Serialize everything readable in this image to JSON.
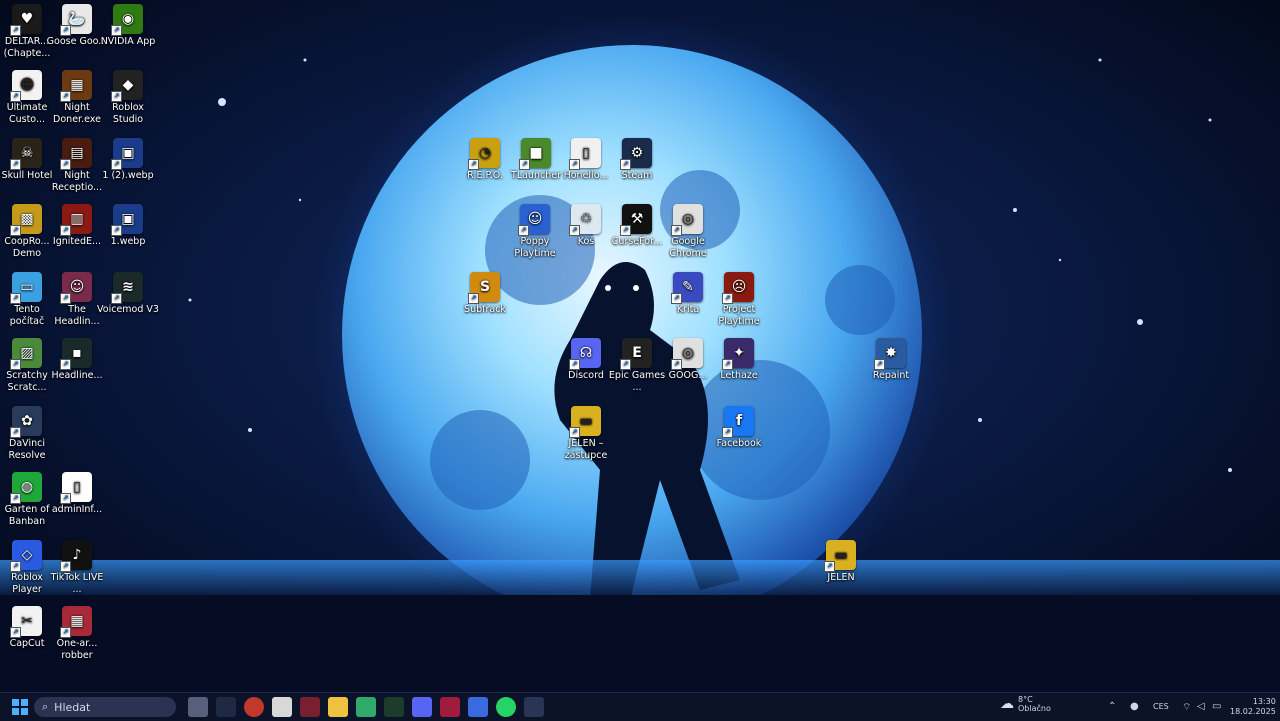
{
  "desktop_icons": [
    {
      "label": "DELTAR... (Chapte...",
      "color": "#1a1a1a",
      "glyph": "♥"
    },
    {
      "label": "Goose Goo...",
      "color": "#e8e8e8",
      "glyph": "🦢"
    },
    {
      "label": "NVIDIA App",
      "color": "#2f7a12",
      "glyph": "◉"
    },
    {
      "label": "Ultimate Custo...",
      "color": "#f2f2f2",
      "glyph": "☻"
    },
    {
      "label": "Night Doner.exe",
      "color": "#6b3a12",
      "glyph": "▦"
    },
    {
      "label": "Roblox Studio",
      "color": "#222",
      "glyph": "◆"
    },
    {
      "label": "Skull Hotel",
      "color": "#2a2418",
      "glyph": "☠"
    },
    {
      "label": "Night Receptio...",
      "color": "#4a1c10",
      "glyph": "▤"
    },
    {
      "label": "1 (2).webp",
      "color": "#1a3c8a",
      "glyph": "▣"
    },
    {
      "label": "CoopRo... Demo",
      "color": "#c49a1a",
      "glyph": "▩"
    },
    {
      "label": "IgnitedE...",
      "color": "#8a1a12",
      "glyph": "▥"
    },
    {
      "label": "1.webp",
      "color": "#1a3c8a",
      "glyph": "▣"
    },
    {
      "label": "Tento počítač",
      "color": "#3aa0e0",
      "glyph": "▭"
    },
    {
      "label": "The Headlin...",
      "color": "#7a2a4a",
      "glyph": "☺"
    },
    {
      "label": "Voicemod V3",
      "color": "#1a2a2a",
      "glyph": "≋"
    },
    {
      "label": "Scratchy Scratc...",
      "color": "#4a8a3a",
      "glyph": "▨"
    },
    {
      "label": "Headline...",
      "color": "#1a2a2a",
      "glyph": "▪"
    },
    {
      "label": "DaVinci Resolve",
      "color": "#2a3a5a",
      "glyph": "✿"
    },
    {
      "label": "Garten of Banban",
      "color": "#1ea83a",
      "glyph": "◍"
    },
    {
      "label": "adminInf...",
      "color": "#ffffff",
      "glyph": "▯"
    },
    {
      "label": "Roblox Player",
      "color": "#2a5ae0",
      "glyph": "◇"
    },
    {
      "label": "TikTok LIVE ...",
      "color": "#111",
      "glyph": "♪"
    },
    {
      "label": "CapCut",
      "color": "#f2f2f2",
      "glyph": "✂"
    },
    {
      "label": "One-ar... robber",
      "color": "#a82a3a",
      "glyph": "▦"
    },
    {
      "label": "R.E.P.O.",
      "color": "#c8a010",
      "glyph": "◔"
    },
    {
      "label": "TLauncher",
      "color": "#4a8a2a",
      "glyph": "■"
    },
    {
      "label": "Honelio...",
      "color": "#f0f0f0",
      "glyph": "▯"
    },
    {
      "label": "Steam",
      "color": "#1a2a4a",
      "glyph": "⚙"
    },
    {
      "label": "Poppy Playtime",
      "color": "#2a60d0",
      "glyph": "☺"
    },
    {
      "label": "Koš",
      "color": "#dde8f0",
      "glyph": "♲"
    },
    {
      "label": "CurseFor...",
      "color": "#111",
      "glyph": "⚒"
    },
    {
      "label": "Google Chrome",
      "color": "#e0e0e0",
      "glyph": "◎"
    },
    {
      "label": "Subfrack",
      "color": "#d08a10",
      "glyph": "S"
    },
    {
      "label": "Krita",
      "color": "#3a4ac0",
      "glyph": "✎"
    },
    {
      "label": "Project Playtime",
      "color": "#8a1a10",
      "glyph": "☹"
    },
    {
      "label": "Discord",
      "color": "#5865f2",
      "glyph": "☊"
    },
    {
      "label": "Epic Games ...",
      "color": "#222",
      "glyph": "E"
    },
    {
      "label": "GOOG...",
      "color": "#e0e0e0",
      "glyph": "◎"
    },
    {
      "label": "Lethaze",
      "color": "#3a2a6a",
      "glyph": "✦"
    },
    {
      "label": "Repaint",
      "color": "#2a5aa0",
      "glyph": "✸"
    },
    {
      "label": "JELEN – zástupce",
      "color": "#d8b020",
      "glyph": "▬"
    },
    {
      "label": "Facebook",
      "color": "#1877f2",
      "glyph": "f"
    },
    {
      "label": "JELEN",
      "color": "#d8b020",
      "glyph": "▬"
    }
  ],
  "taskbar": {
    "search_placeholder": "Hledat",
    "weather_temp": "8°C",
    "weather_text": "Oblačno",
    "language": "CES",
    "time": "13:30",
    "date": "18.02.2025"
  }
}
